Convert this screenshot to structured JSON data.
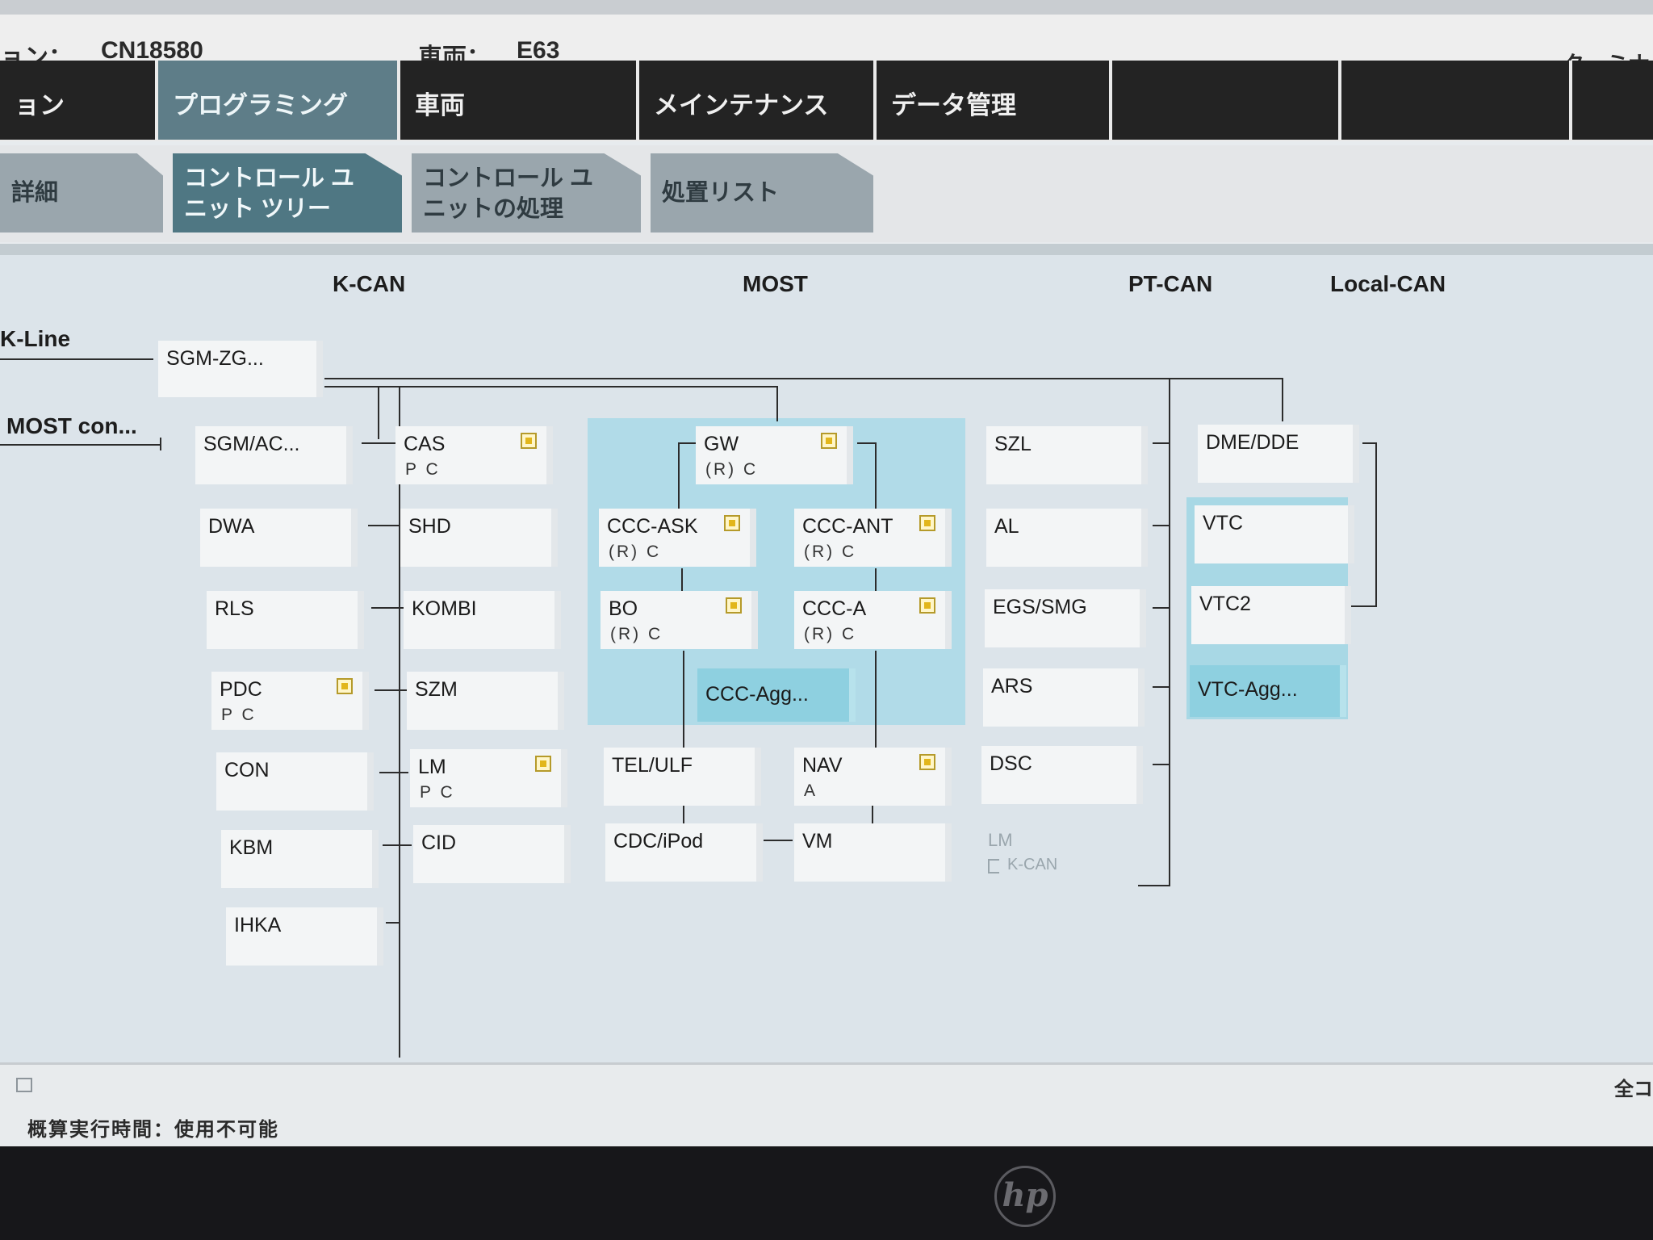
{
  "header": {
    "session_label": "ョン：",
    "session_value": "CN18580",
    "vehicle_label": "車両：",
    "vehicle_value": "E63",
    "terminal_label": "ターミナ"
  },
  "main_menu": [
    {
      "label": "ョン",
      "active": false
    },
    {
      "label": "プログラミング",
      "active": true
    },
    {
      "label": "車両",
      "active": false
    },
    {
      "label": "メインテナンス",
      "active": false
    },
    {
      "label": "データ管理",
      "active": false
    },
    {
      "label": "",
      "active": false
    },
    {
      "label": "",
      "active": false
    }
  ],
  "sub_tabs": [
    {
      "label": "詳細",
      "active": false
    },
    {
      "label_line1": "コントロール ユ",
      "label_line2": "ニット ツリー",
      "active": true
    },
    {
      "label_line1": "コントロール ユ",
      "label_line2": "ニットの処理",
      "active": false
    },
    {
      "label": "処置リスト",
      "active": false
    }
  ],
  "tree": {
    "bus_headers": [
      "K-CAN",
      "MOST",
      "PT-CAN",
      "Local-CAN"
    ],
    "k_line_label": "K-Line",
    "most_con_label": "MOST con...",
    "root_node": "SGM-ZG...",
    "col1": [
      {
        "name": "SGM/AC...",
        "sub": ""
      },
      {
        "name": "DWA",
        "sub": ""
      },
      {
        "name": "RLS",
        "sub": ""
      },
      {
        "name": "PDC",
        "sub": "P C",
        "flag": true
      },
      {
        "name": "CON",
        "sub": ""
      },
      {
        "name": "KBM",
        "sub": ""
      },
      {
        "name": "IHKA",
        "sub": ""
      }
    ],
    "col2": [
      {
        "name": "CAS",
        "sub": "P C",
        "flag": true
      },
      {
        "name": "SHD",
        "sub": ""
      },
      {
        "name": "KOMBI",
        "sub": ""
      },
      {
        "name": "SZM",
        "sub": ""
      },
      {
        "name": "LM",
        "sub": "P C",
        "flag": true
      },
      {
        "name": "CID",
        "sub": ""
      }
    ],
    "most": {
      "gw": {
        "name": "GW",
        "sub": "(R) C",
        "flag": true
      },
      "ccc_ask": {
        "name": "CCC-ASK",
        "sub": "(R) C",
        "flag": true
      },
      "ccc_ant": {
        "name": "CCC-ANT",
        "sub": "(R) C",
        "flag": true
      },
      "bo": {
        "name": "BO",
        "sub": "(R) C",
        "flag": true
      },
      "ccc_a": {
        "name": "CCC-A",
        "sub": "(R) C",
        "flag": true
      },
      "ccc_agg": {
        "name": "CCC-Agg..."
      },
      "tel_ulf": {
        "name": "TEL/ULF",
        "sub": ""
      },
      "nav": {
        "name": "NAV",
        "sub": "A",
        "flag": true
      },
      "cdc_ipod": {
        "name": "CDC/iPod",
        "sub": ""
      },
      "vm": {
        "name": "VM",
        "sub": ""
      }
    },
    "ptcan": [
      {
        "name": "SZL"
      },
      {
        "name": "AL"
      },
      {
        "name": "EGS/SMG"
      },
      {
        "name": "ARS"
      },
      {
        "name": "DSC"
      },
      {
        "name": "LM",
        "sub": "K-CAN",
        "inactive": true
      }
    ],
    "localcan": [
      {
        "name": "DME/DDE"
      },
      {
        "name": "VTC"
      },
      {
        "name": "VTC2"
      },
      {
        "name": "VTC-Agg...",
        "agg": true
      }
    ]
  },
  "status": {
    "text": "概算実行時間：使用不可能",
    "right_label": "全コ"
  },
  "bezel": {
    "logo": "hp"
  },
  "colors": {
    "menu_bg": "#232323",
    "menu_active": "#5e7d88",
    "subtab_active": "#4f7783",
    "subtab": "#9aa6ad",
    "most_panel": "#a9d9e7",
    "agg_node": "#8ed0e0",
    "flag": "#e2b61b"
  }
}
